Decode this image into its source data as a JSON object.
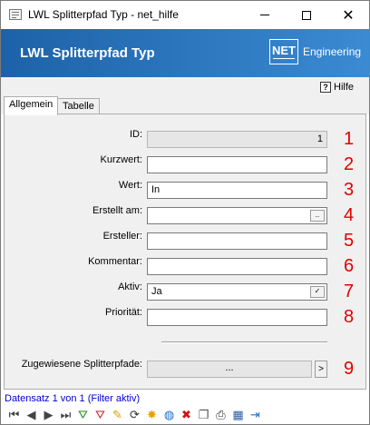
{
  "window": {
    "title": "LWL Splitterpfad Typ - net_hilfe",
    "minimize_icon": "minimize-icon",
    "maximize_icon": "maximize-icon",
    "close_icon": "close-icon",
    "close_glyph": "✕"
  },
  "header": {
    "title": "LWL Splitterpfad Typ",
    "logo_mark": "NET",
    "logo_text": "Engineering",
    "gradient_start": "#1d62a8",
    "gradient_end": "#3b8ad2"
  },
  "help": {
    "icon_glyph": "?",
    "label": "Hilfe"
  },
  "tabs": [
    {
      "label": "Allgemein",
      "active": true
    },
    {
      "label": "Tabelle",
      "active": false
    }
  ],
  "form": {
    "id": {
      "label": "ID:",
      "value": "1",
      "marker": "1"
    },
    "kurzwert": {
      "label": "Kurzwert:",
      "value": "",
      "marker": "2"
    },
    "wert": {
      "label": "Wert:",
      "value": "In",
      "marker": "3"
    },
    "erstellt_am": {
      "label": "Erstellt am:",
      "value": "",
      "button": "..",
      "marker": "4"
    },
    "ersteller": {
      "label": "Ersteller:",
      "value": "",
      "marker": "5"
    },
    "kommentar": {
      "label": "Kommentar:",
      "value": "",
      "marker": "6"
    },
    "aktiv": {
      "label": "Aktiv:",
      "value": "Ja",
      "button": "✓",
      "marker": "7"
    },
    "prioritaet": {
      "label": "Priorität:",
      "value": "",
      "marker": "8"
    },
    "splitterpfade": {
      "label": "Zugewiesene Splitterpfade:",
      "value": "...",
      "button": ">",
      "marker": "9"
    }
  },
  "marker_color": "#e00000",
  "status": {
    "text": "Datensatz 1 von 1 (Filter aktiv)",
    "color": "#0000d0"
  },
  "navbar": [
    {
      "name": "first-record-icon",
      "glyph": "⏮",
      "color": "#444"
    },
    {
      "name": "previous-record-icon",
      "glyph": "◀",
      "color": "#444"
    },
    {
      "name": "next-record-icon",
      "glyph": "▶",
      "color": "#444"
    },
    {
      "name": "last-record-icon",
      "glyph": "⏭",
      "color": "#444"
    },
    {
      "name": "add-filter-icon",
      "glyph": "⛛",
      "color": "#1a8a1a"
    },
    {
      "name": "remove-filter-icon",
      "glyph": "⛛",
      "color": "#c02020"
    },
    {
      "name": "edit-pencil-icon",
      "glyph": "✎",
      "color": "#d79a00"
    },
    {
      "name": "refresh-icon",
      "glyph": "⟳",
      "color": "#333"
    },
    {
      "name": "new-record-icon",
      "glyph": "✸",
      "color": "#e8a000"
    },
    {
      "name": "web-icon",
      "glyph": "◍",
      "color": "#1e6fc9"
    },
    {
      "name": "delete-icon",
      "glyph": "✖",
      "color": "#d01010"
    },
    {
      "name": "copy-icon",
      "glyph": "❐",
      "color": "#555"
    },
    {
      "name": "print-icon",
      "glyph": "⎙",
      "color": "#333"
    },
    {
      "name": "export-icon",
      "glyph": "▦",
      "color": "#2d5fa6"
    },
    {
      "name": "exit-icon",
      "glyph": "⇥",
      "color": "#1e6fc9"
    }
  ]
}
